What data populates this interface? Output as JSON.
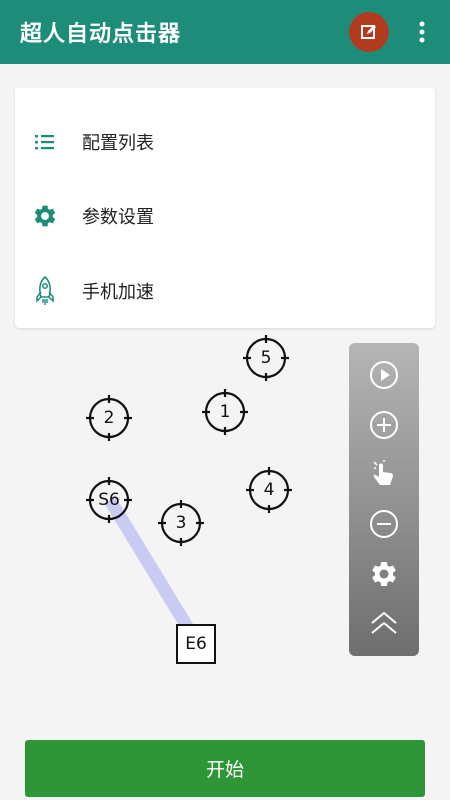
{
  "appbar": {
    "title": "超人自动点击器"
  },
  "menu": {
    "items": [
      {
        "label": "配置列表",
        "icon": "list-icon"
      },
      {
        "label": "参数设置",
        "icon": "gear-icon"
      },
      {
        "label": "手机加速",
        "icon": "rocket-icon"
      }
    ]
  },
  "targets": [
    {
      "label": "1"
    },
    {
      "label": "2"
    },
    {
      "label": "3"
    },
    {
      "label": "4"
    },
    {
      "label": "5"
    },
    {
      "label": "S6"
    }
  ],
  "swipe_end": {
    "label": "E6"
  },
  "floatbar": {
    "buttons": [
      "play-icon",
      "add-icon",
      "tap-gesture-icon",
      "remove-icon",
      "settings-icon",
      "collapse-up-icon"
    ]
  },
  "start_button": {
    "label": "开始"
  },
  "colors": {
    "appbar": "#1d8c79",
    "edit_button": "#b23a1f",
    "start_button": "#2f9637",
    "swipe_line": "#c9cbf2"
  }
}
